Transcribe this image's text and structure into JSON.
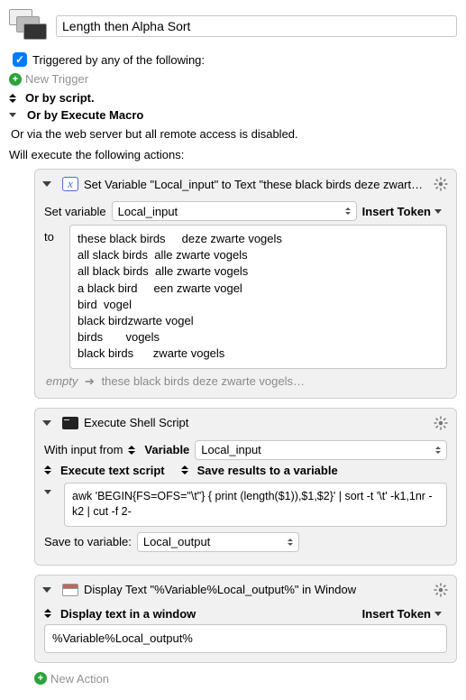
{
  "title": "Length then Alpha Sort",
  "triggers": {
    "header": "Triggered by any of the following:",
    "new_trigger": "New Trigger",
    "by_script": "Or by script.",
    "by_macro": "Or by Execute Macro",
    "web_note": "Or via the web server but all remote access is disabled."
  },
  "actions_header": "Will execute the following actions:",
  "action1": {
    "title": "Set Variable \"Local_input\" to Text \"these black birds     deze zwarte v…",
    "set_label": "Set variable",
    "var_name": "Local_input",
    "insert_token": "Insert Token",
    "to_label": "to",
    "text": "these black birds     deze zwarte vogels\nall slack birds  alle zwarte vogels\nall black birds  alle zwarte vogels\na black bird     een zwarte vogel\nbird  vogel\nblack birdzwarte vogel\nbirds       vogels\nblack birds      zwarte vogels",
    "hint_empty": "empty",
    "hint_text": "these black birds  deze zwarte vogels…"
  },
  "action2": {
    "title": "Execute Shell Script",
    "with_input": "With input from",
    "variable_label": "Variable",
    "var_name": "Local_input",
    "execute_label": "Execute text script",
    "save_label": "Save results to a variable",
    "script": "awk 'BEGIN{FS=OFS=\"\\t\"} { print (length($1)),$1,$2}' | sort -t '\\t' -k1,1nr -k2 | cut -f 2-",
    "save_to": "Save to variable:",
    "out_var": "Local_output"
  },
  "action3": {
    "title": "Display Text \"%Variable%Local_output%\" in Window",
    "display_label": "Display text in a window",
    "insert_token": "Insert Token",
    "text": "%Variable%Local_output%"
  },
  "new_action": "New Action"
}
